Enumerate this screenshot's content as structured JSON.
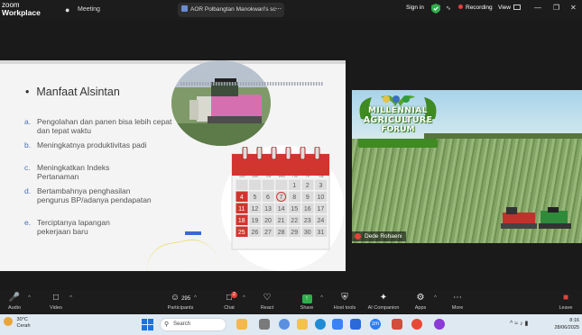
{
  "app": {
    "brand_line1": "zoom",
    "brand_line2": "Workplace"
  },
  "titlebar": {
    "meeting_tab": "Meeting",
    "doc_tab": "AOR Polbangtan Manokwari's sc",
    "sign_in": "Sign in",
    "recording": "Recording",
    "view": "View"
  },
  "slide": {
    "title": "Manfaat Alsintan",
    "bullet": "•",
    "items": [
      {
        "letter": "a.",
        "text": "Pengolahan dan panen bisa lebih cepat dan tepat waktu"
      },
      {
        "letter": "b.",
        "text": "Meningkatnya produktivitas padi"
      },
      {
        "letter": "c.",
        "text": "Meningkatkan Indeks Pertanaman"
      },
      {
        "letter": "d.",
        "text": "Bertambahnya penghasilan pengurus BP/adanya pendapatan"
      },
      {
        "letter": "e.",
        "text": "Terciptanya lapangan pekerjaan baru"
      }
    ],
    "calendar": {
      "days": [
        "Sun",
        "Mon",
        "Tue",
        "Wed",
        "Thu",
        "Fri",
        "Sat"
      ],
      "cells": [
        "",
        "",
        "",
        "",
        "1",
        "2",
        "3",
        "4",
        "5",
        "6",
        "7",
        "8",
        "9",
        "10",
        "11",
        "12",
        "13",
        "14",
        "15",
        "16",
        "17",
        "18",
        "19",
        "20",
        "21",
        "22",
        "23",
        "24",
        "25",
        "26",
        "27",
        "28",
        "29",
        "30",
        "31"
      ]
    }
  },
  "video": {
    "banner_line1": "MILLENNIAL",
    "banner_line2": "AGRICULTURE",
    "banner_line3": "FORUM",
    "participant_name": "Dede Rohaeni"
  },
  "toolbar": {
    "audio": "Audio",
    "video": "Video",
    "participants": "Participants",
    "participants_count": "295",
    "chat": "Chat",
    "chat_badge": "2",
    "react": "React",
    "share": "Share",
    "host_tools": "Host tools",
    "ai_companion": "AI Companion",
    "apps": "Apps",
    "more": "More",
    "leave": "Leave"
  },
  "taskbar": {
    "temp": "30°C",
    "condition": "Cerah",
    "search_placeholder": "Search",
    "time": "8:16",
    "date": "28/06/2025"
  },
  "colors": {
    "recording_dot": "#e5413b",
    "accent_blue": "#4a6fb0",
    "calendar_red": "#d2352f"
  }
}
